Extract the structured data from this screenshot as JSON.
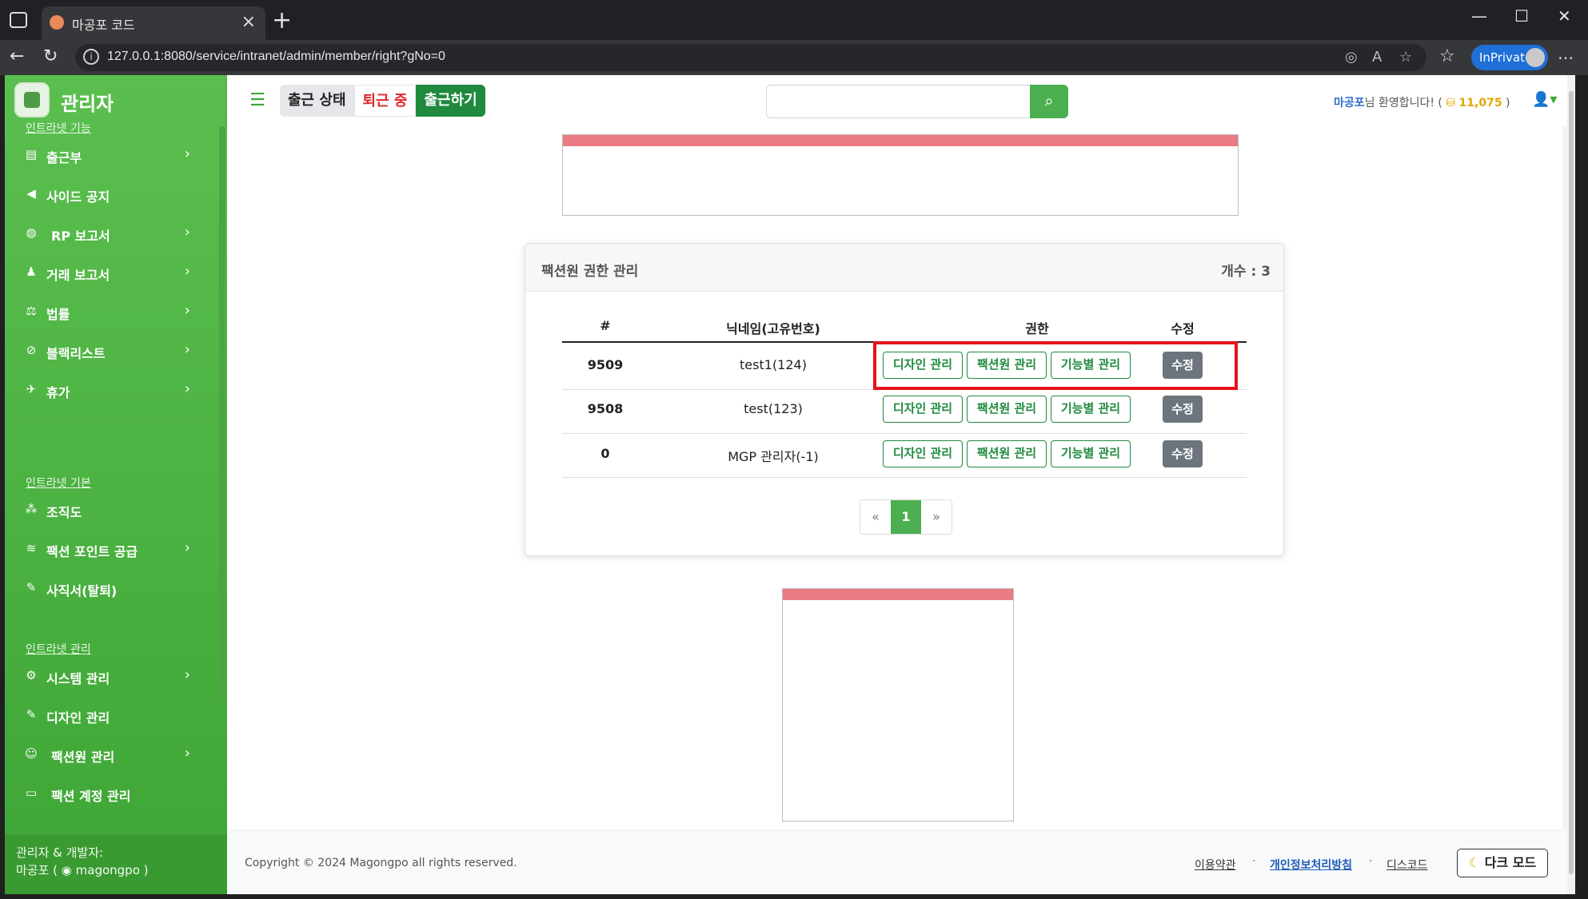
{
  "browser": {
    "tab_title": "마공포 코드",
    "url": "127.0.0.1:8080/service/intranet/admin/member/right?gNo=0",
    "inprivate_label": "InPrivate"
  },
  "sidebar": {
    "brand": "관리자",
    "sections": [
      {
        "title": "인트라넷 기능"
      },
      {
        "title": "인트라넷 기본"
      },
      {
        "title": "인트라넷 관리"
      }
    ],
    "items": [
      {
        "label": "출근부",
        "icon": "book-icon"
      },
      {
        "label": "사이드 공지",
        "icon": "megaphone-icon"
      },
      {
        "label": "RP 보고서",
        "icon": "gamepad-icon"
      },
      {
        "label": "거래 보고서",
        "icon": "money-bag-icon"
      },
      {
        "label": "법률",
        "icon": "scale-icon"
      },
      {
        "label": "블랙리스트",
        "icon": "ban-icon"
      },
      {
        "label": "휴가",
        "icon": "plane-icon"
      },
      {
        "label": "조직도",
        "icon": "sitemap-icon"
      },
      {
        "label": "팩션 포인트 공급",
        "icon": "coins-icon"
      },
      {
        "label": "사직서(탈퇴)",
        "icon": "pen-icon"
      },
      {
        "label": "시스템 관리",
        "icon": "gear-icon"
      },
      {
        "label": "디자인 관리",
        "icon": "brush-icon"
      },
      {
        "label": "팩션원 관리",
        "icon": "user-gear-icon"
      },
      {
        "label": "팩션 계정 관리",
        "icon": "id-card-icon"
      }
    ],
    "footer_line1": "관리자 & 개발자:",
    "footer_line2": "마공포 ( ◉ magongpo )"
  },
  "topbar": {
    "attendance_status": "출근 상태",
    "attendance_state": "퇴근 중",
    "checkin_button": "출근하기",
    "search_placeholder": "",
    "welcome_nick": "마공포",
    "welcome_text": "님 환영합니다! (",
    "points": "11,075",
    "welcome_end": ")"
  },
  "card": {
    "title": "팩션원 권한 관리",
    "count": "개수 : 3",
    "headers": [
      "#",
      "닉네임(고유번호)",
      "권한",
      "수정"
    ],
    "rows": [
      {
        "id": "9509",
        "nick": "test1(124)"
      },
      {
        "id": "9508",
        "nick": "test(123)"
      },
      {
        "id": "0",
        "nick": "MGP 관리자(-1)"
      }
    ],
    "perm_buttons": [
      "디자인 관리",
      "팩션원 관리",
      "기능별 관리"
    ],
    "edit_button": "수정",
    "pager": {
      "prev": "«",
      "current": "1",
      "next": "»"
    }
  },
  "footer": {
    "copyright": "Copyright © 2024 Magongpo all rights reserved.",
    "terms": "이용약관",
    "privacy": "개인정보처리방침",
    "discord": "디스코드",
    "dark_mode": "다크 모드"
  },
  "colors": {
    "sidebar_green": "#4caf50",
    "checkin_green": "#1f8a3e",
    "highlight_red": "#e4121c",
    "ad_pink": "#eb7b83"
  }
}
